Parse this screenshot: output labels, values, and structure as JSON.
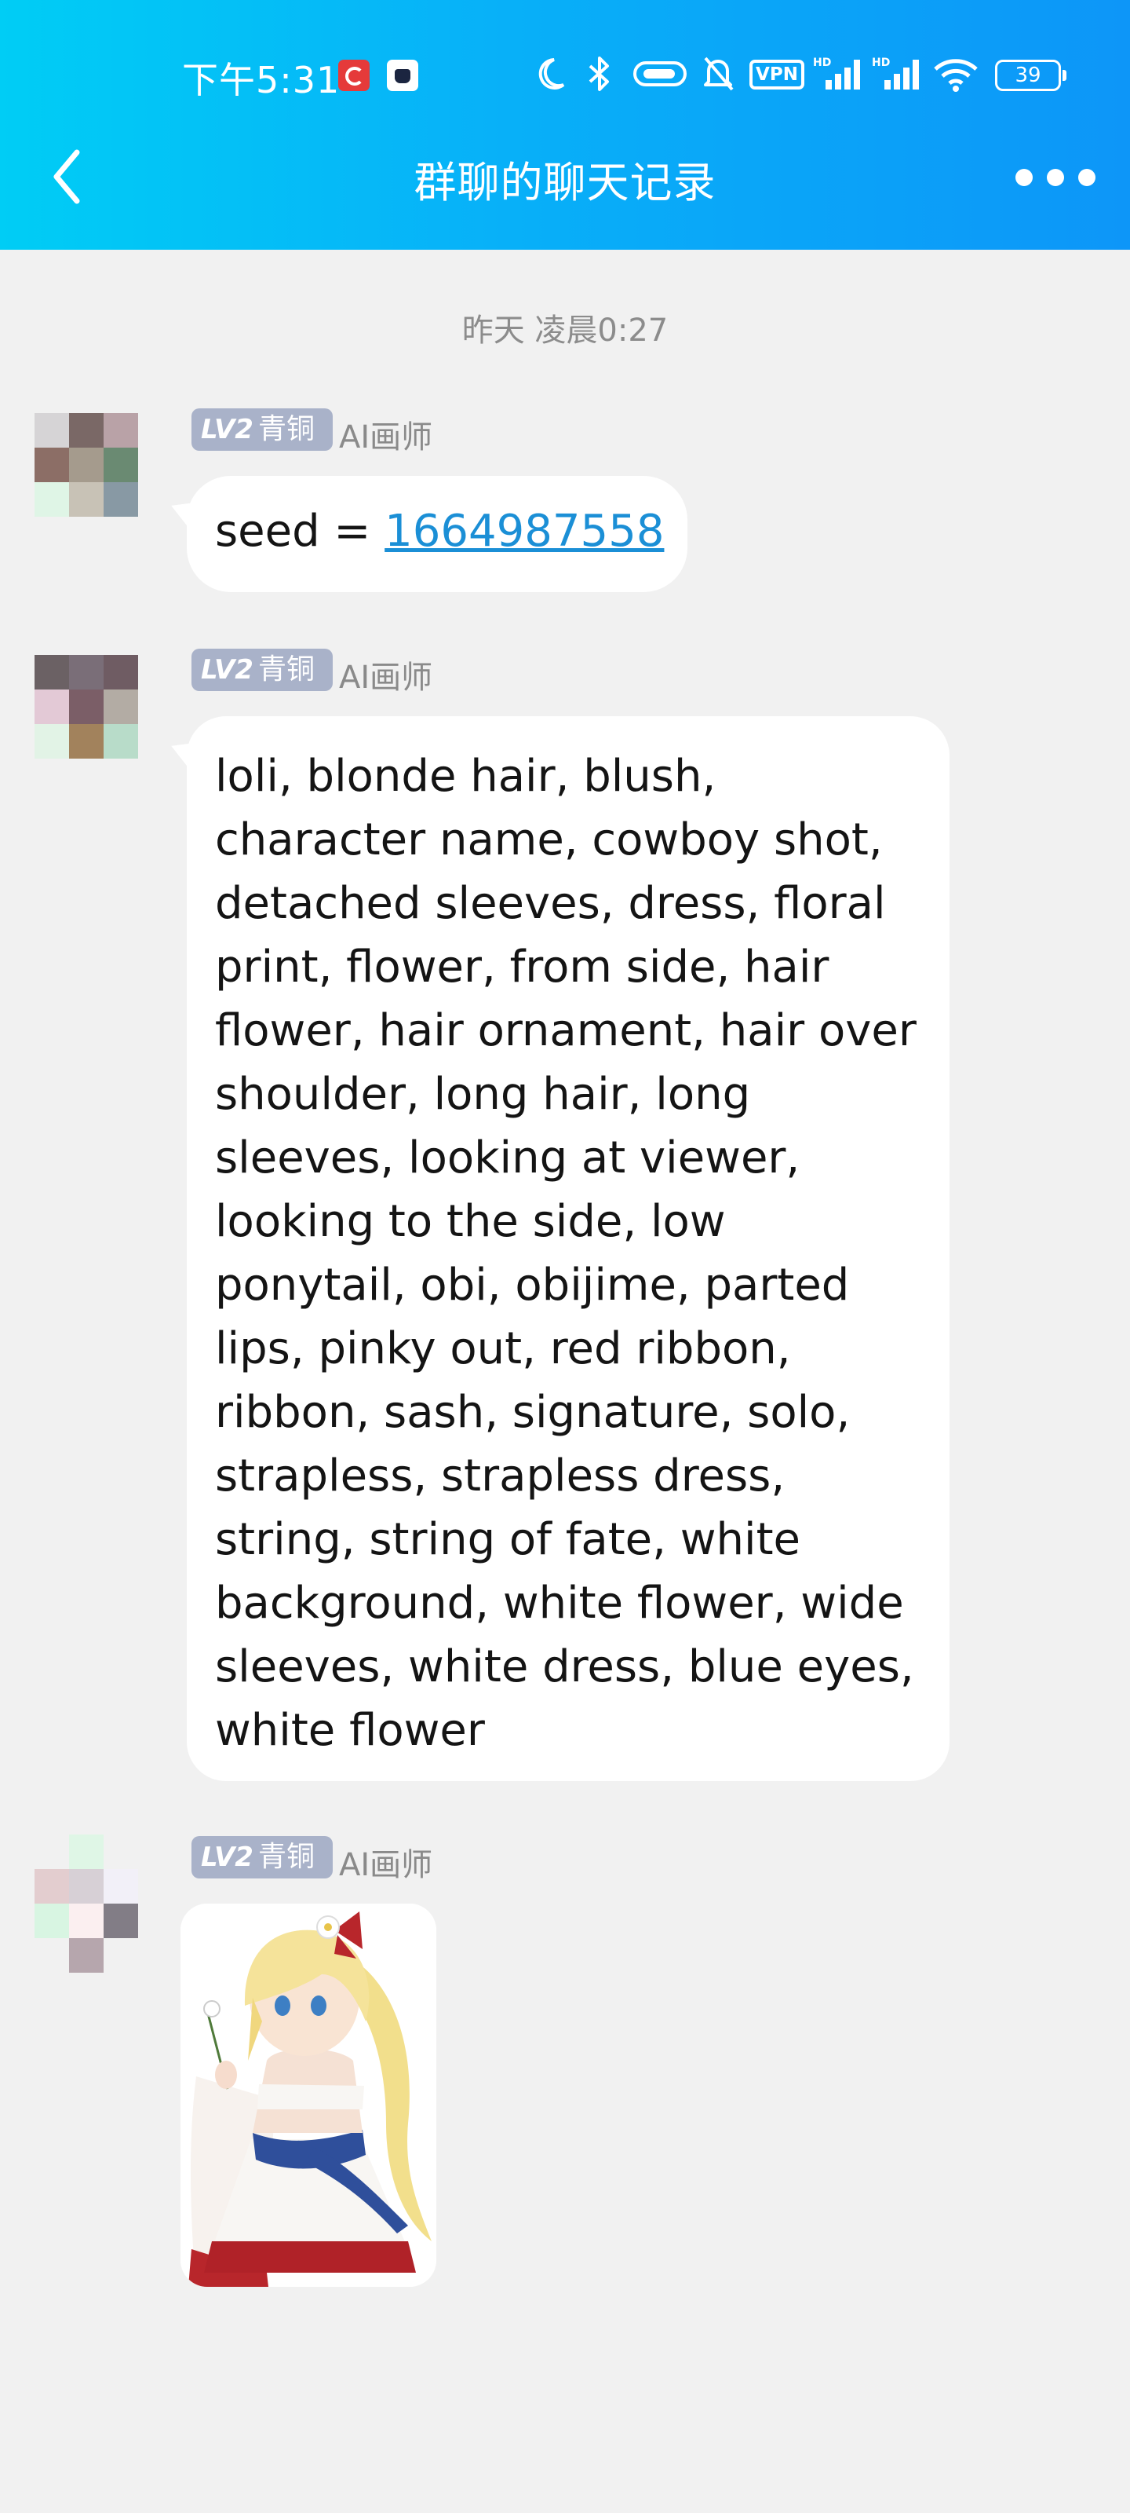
{
  "status_bar": {
    "time": "下午5:31",
    "vpn_label": "VPN",
    "battery_level": "39",
    "icons": [
      "netease-music-icon",
      "app-notification-icon",
      "moon-icon",
      "bluetooth-icon",
      "capsule-icon",
      "mute-bell-icon",
      "vpn-icon",
      "hd-signal-icon",
      "hd-signal-icon",
      "wifi-icon",
      "battery-icon"
    ]
  },
  "header": {
    "title": "群聊的聊天记录",
    "back_icon": "chevron-left-icon",
    "more_icon": "more-dots-icon",
    "gradient_colors": [
      "#00cdf5",
      "#0d96f8"
    ]
  },
  "timestamp": "昨天 凌晨0:27",
  "messages": [
    {
      "level_code": "LV2",
      "level_name": "青铜",
      "sender": "AI画师",
      "prefix": "seed = ",
      "link": "1664987558"
    },
    {
      "level_code": "LV2",
      "level_name": "青铜",
      "sender": "AI画师",
      "text": "loli, blonde hair, blush, character name, cowboy shot, detached sleeves, dress, floral print, flower, from side, hair flower, hair ornament, hair over shoulder, long hair, long sleeves, looking at viewer, looking to the side, low ponytail, obi, obijime, parted lips, pinky out, red ribbon, ribbon, sash, signature, solo, strapless, strapless dress, string, string of fate, white background, white flower, wide sleeves, white dress, blue eyes, white flower"
    },
    {
      "level_code": "LV2",
      "level_name": "青铜",
      "sender": "AI画师",
      "image": "anime-girl-illustration"
    }
  ],
  "colors": {
    "page_background": "#f1f1f1",
    "link": "#1b8fd6",
    "badge": "#a9b2c9"
  }
}
